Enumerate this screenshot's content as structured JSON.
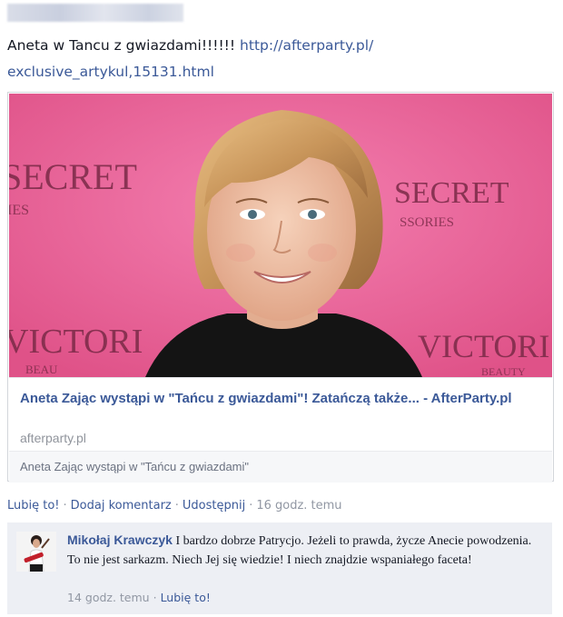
{
  "post": {
    "text": "Aneta w Tancu z gwiazdami!!!!!! ",
    "link_line1": "http://afterparty.pl/",
    "link_line2": "exclusive_artykul,15131.html"
  },
  "link_card": {
    "title": "Aneta Zając wystąpi w \"Tańcu z gwiazdami\"! Zatańczą także... - AfterParty.pl",
    "domain": "afterparty.pl",
    "description": "Aneta Zając wystąpi w \"Tańcu z gwiazdami\"",
    "image": {
      "background_left_text_1": "SECRET",
      "background_left_text_2": "IES",
      "background_right_text_1": "SECRET",
      "background_right_text_2": "SSORIES",
      "background_bottom_left": "VICTORI",
      "background_bottom_left_sub": "BEAU",
      "background_bottom_right": "VICTORI",
      "background_bottom_right_sub": "BEAUTY",
      "colors": {
        "backdrop": "#ee6699",
        "hair": "#c8955a",
        "dress": "#141414",
        "skin": "#efc2a8"
      }
    }
  },
  "actions": {
    "like": "Lubię to!",
    "comment": "Dodaj komentarz",
    "share": "Udostępnij",
    "time": "16 godz. temu",
    "separator": "·"
  },
  "comment": {
    "author": "Mikołaj Krawczyk",
    "text": " I bardzo dobrze Patrycjo. Jeżeli to prawda, życze Anecie powodzenia. To nie jest sarkazm. Niech Jej się wiedzie! I niech znajdzie wspaniałego faceta!",
    "time": "14 godz. temu",
    "like": "Lubię to!",
    "separator": "·"
  },
  "colors": {
    "link": "#3b5998",
    "muted": "#9197a3",
    "comment_bg": "#edeff4"
  }
}
